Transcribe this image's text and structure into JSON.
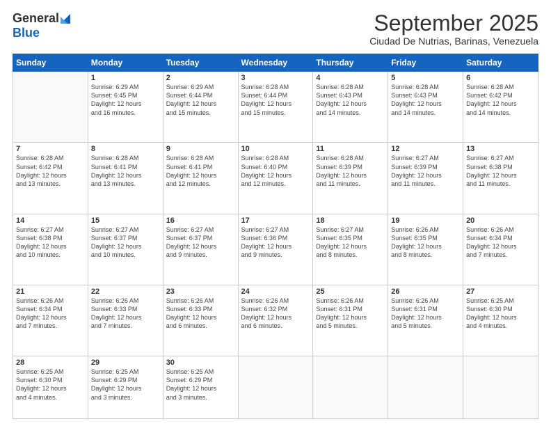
{
  "header": {
    "logo_general": "General",
    "logo_blue": "Blue",
    "month_title": "September 2025",
    "subtitle": "Ciudad De Nutrias, Barinas, Venezuela"
  },
  "days": [
    "Sunday",
    "Monday",
    "Tuesday",
    "Wednesday",
    "Thursday",
    "Friday",
    "Saturday"
  ],
  "weeks": [
    [
      {
        "day": "",
        "text": ""
      },
      {
        "day": "1",
        "text": "Sunrise: 6:29 AM\nSunset: 6:45 PM\nDaylight: 12 hours\nand 16 minutes."
      },
      {
        "day": "2",
        "text": "Sunrise: 6:29 AM\nSunset: 6:44 PM\nDaylight: 12 hours\nand 15 minutes."
      },
      {
        "day": "3",
        "text": "Sunrise: 6:28 AM\nSunset: 6:44 PM\nDaylight: 12 hours\nand 15 minutes."
      },
      {
        "day": "4",
        "text": "Sunrise: 6:28 AM\nSunset: 6:43 PM\nDaylight: 12 hours\nand 14 minutes."
      },
      {
        "day": "5",
        "text": "Sunrise: 6:28 AM\nSunset: 6:43 PM\nDaylight: 12 hours\nand 14 minutes."
      },
      {
        "day": "6",
        "text": "Sunrise: 6:28 AM\nSunset: 6:42 PM\nDaylight: 12 hours\nand 14 minutes."
      }
    ],
    [
      {
        "day": "7",
        "text": "Sunrise: 6:28 AM\nSunset: 6:42 PM\nDaylight: 12 hours\nand 13 minutes."
      },
      {
        "day": "8",
        "text": "Sunrise: 6:28 AM\nSunset: 6:41 PM\nDaylight: 12 hours\nand 13 minutes."
      },
      {
        "day": "9",
        "text": "Sunrise: 6:28 AM\nSunset: 6:41 PM\nDaylight: 12 hours\nand 12 minutes."
      },
      {
        "day": "10",
        "text": "Sunrise: 6:28 AM\nSunset: 6:40 PM\nDaylight: 12 hours\nand 12 minutes."
      },
      {
        "day": "11",
        "text": "Sunrise: 6:28 AM\nSunset: 6:39 PM\nDaylight: 12 hours\nand 11 minutes."
      },
      {
        "day": "12",
        "text": "Sunrise: 6:27 AM\nSunset: 6:39 PM\nDaylight: 12 hours\nand 11 minutes."
      },
      {
        "day": "13",
        "text": "Sunrise: 6:27 AM\nSunset: 6:38 PM\nDaylight: 12 hours\nand 11 minutes."
      }
    ],
    [
      {
        "day": "14",
        "text": "Sunrise: 6:27 AM\nSunset: 6:38 PM\nDaylight: 12 hours\nand 10 minutes."
      },
      {
        "day": "15",
        "text": "Sunrise: 6:27 AM\nSunset: 6:37 PM\nDaylight: 12 hours\nand 10 minutes."
      },
      {
        "day": "16",
        "text": "Sunrise: 6:27 AM\nSunset: 6:37 PM\nDaylight: 12 hours\nand 9 minutes."
      },
      {
        "day": "17",
        "text": "Sunrise: 6:27 AM\nSunset: 6:36 PM\nDaylight: 12 hours\nand 9 minutes."
      },
      {
        "day": "18",
        "text": "Sunrise: 6:27 AM\nSunset: 6:35 PM\nDaylight: 12 hours\nand 8 minutes."
      },
      {
        "day": "19",
        "text": "Sunrise: 6:26 AM\nSunset: 6:35 PM\nDaylight: 12 hours\nand 8 minutes."
      },
      {
        "day": "20",
        "text": "Sunrise: 6:26 AM\nSunset: 6:34 PM\nDaylight: 12 hours\nand 7 minutes."
      }
    ],
    [
      {
        "day": "21",
        "text": "Sunrise: 6:26 AM\nSunset: 6:34 PM\nDaylight: 12 hours\nand 7 minutes."
      },
      {
        "day": "22",
        "text": "Sunrise: 6:26 AM\nSunset: 6:33 PM\nDaylight: 12 hours\nand 7 minutes."
      },
      {
        "day": "23",
        "text": "Sunrise: 6:26 AM\nSunset: 6:33 PM\nDaylight: 12 hours\nand 6 minutes."
      },
      {
        "day": "24",
        "text": "Sunrise: 6:26 AM\nSunset: 6:32 PM\nDaylight: 12 hours\nand 6 minutes."
      },
      {
        "day": "25",
        "text": "Sunrise: 6:26 AM\nSunset: 6:31 PM\nDaylight: 12 hours\nand 5 minutes."
      },
      {
        "day": "26",
        "text": "Sunrise: 6:26 AM\nSunset: 6:31 PM\nDaylight: 12 hours\nand 5 minutes."
      },
      {
        "day": "27",
        "text": "Sunrise: 6:25 AM\nSunset: 6:30 PM\nDaylight: 12 hours\nand 4 minutes."
      }
    ],
    [
      {
        "day": "28",
        "text": "Sunrise: 6:25 AM\nSunset: 6:30 PM\nDaylight: 12 hours\nand 4 minutes."
      },
      {
        "day": "29",
        "text": "Sunrise: 6:25 AM\nSunset: 6:29 PM\nDaylight: 12 hours\nand 3 minutes."
      },
      {
        "day": "30",
        "text": "Sunrise: 6:25 AM\nSunset: 6:29 PM\nDaylight: 12 hours\nand 3 minutes."
      },
      {
        "day": "",
        "text": ""
      },
      {
        "day": "",
        "text": ""
      },
      {
        "day": "",
        "text": ""
      },
      {
        "day": "",
        "text": ""
      }
    ]
  ]
}
